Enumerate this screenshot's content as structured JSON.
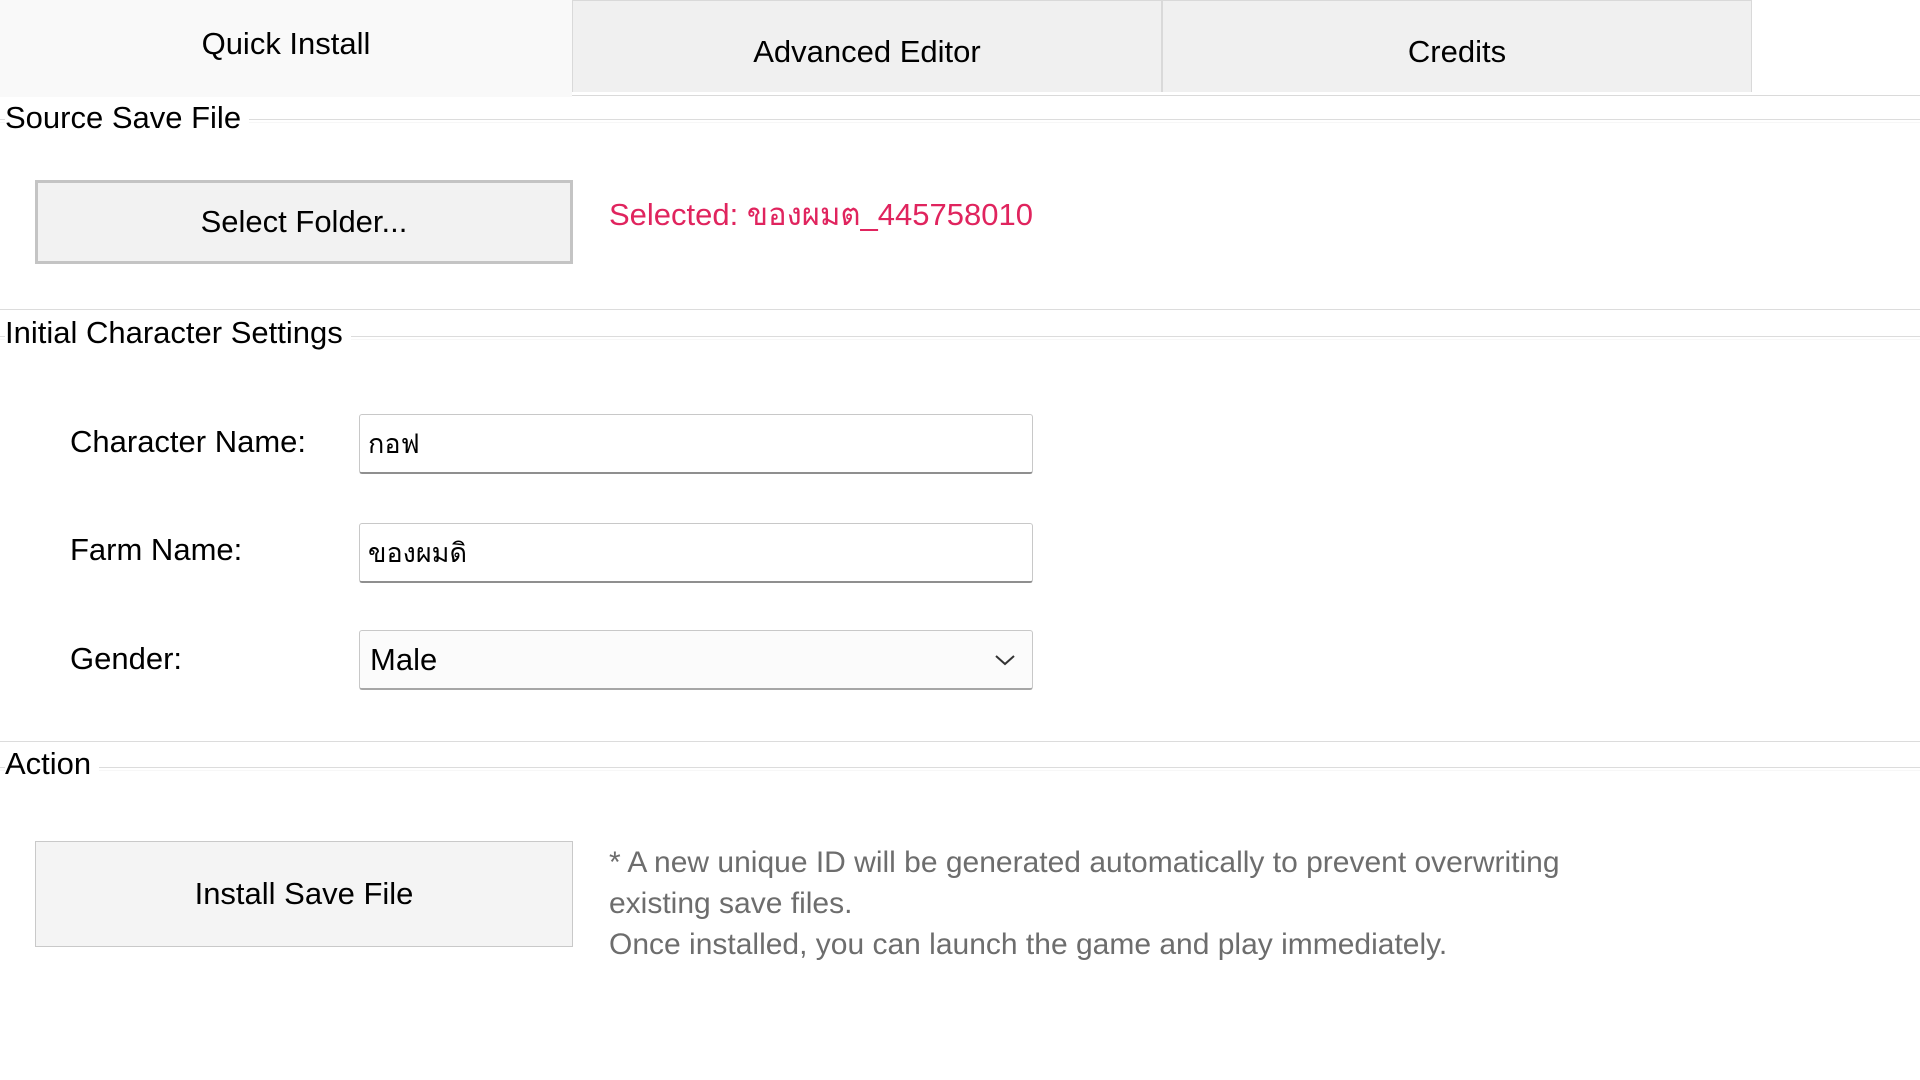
{
  "tabs": [
    {
      "label": "Quick Install",
      "active": true
    },
    {
      "label": "Advanced Editor",
      "active": false
    },
    {
      "label": "Credits",
      "active": false
    }
  ],
  "source_section": {
    "title": "Source Save File",
    "select_button_label": "Select Folder...",
    "selected_text": "Selected: ของผมต_445758010",
    "selected_color": "#e0245e"
  },
  "character_section": {
    "title": "Initial Character Settings",
    "character_name_label": "Character Name:",
    "character_name_value": "กอฟ",
    "farm_name_label": "Farm Name:",
    "farm_name_value": "ของผมดิ",
    "gender_label": "Gender:",
    "gender_value": "Male",
    "gender_icon": "chevron-down-icon"
  },
  "action_section": {
    "title": "Action",
    "install_button_label": "Install Save File",
    "note_line_1": "* A new unique ID will be generated automatically to prevent overwriting",
    "note_line_2": "existing save files.",
    "note_line_3": "Once installed, you can launch the game and play immediately."
  }
}
